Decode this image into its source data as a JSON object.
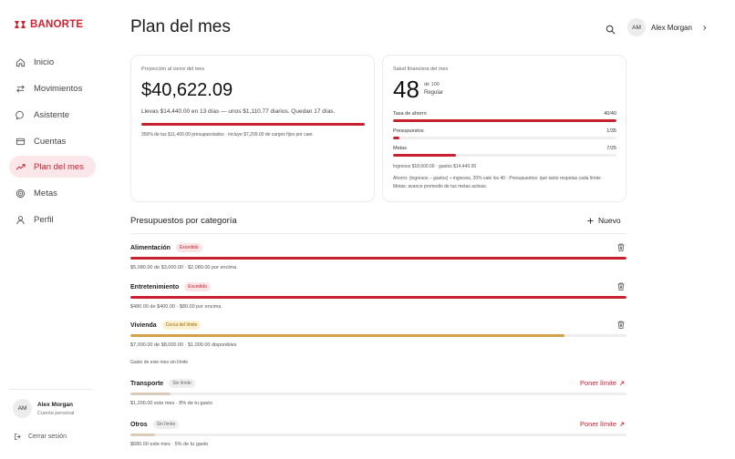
{
  "brand": {
    "name": "BANORTE",
    "color": "#d1202f"
  },
  "sidebar": {
    "items": [
      {
        "label": "Inicio",
        "icon": "home-icon"
      },
      {
        "label": "Movimientos",
        "icon": "transfer-icon"
      },
      {
        "label": "Asistente",
        "icon": "chat-icon"
      },
      {
        "label": "Cuentas",
        "icon": "card-icon"
      },
      {
        "label": "Plan del mes",
        "icon": "trend-icon",
        "active": true
      },
      {
        "label": "Metas",
        "icon": "target-icon"
      },
      {
        "label": "Perfil",
        "icon": "user-icon"
      }
    ],
    "user": {
      "initials": "AM",
      "name": "Alex Morgan",
      "subtitle": "Cuenta personal"
    },
    "logout_label": "Cerrar sesión"
  },
  "header": {
    "title": "Plan del mes",
    "user": {
      "initials": "AM",
      "name": "Alex Morgan"
    }
  },
  "projection": {
    "label": "Proyección al cierre del mes",
    "amount": "$40,622.09",
    "description": "Llevas $14,440.00 en 13 días — unos $1,110.77 diarios. Quedan 17 días.",
    "progress": 1.0,
    "footnote": "356% de tus $11,400.00 presupuestados · incluye $7,299.00 de cargos fijos por caer."
  },
  "health": {
    "label": "Salud financiera del mes",
    "score": "48",
    "out_of": "de 100",
    "status": "Regular",
    "metrics": [
      {
        "label": "Tasa de ahorro",
        "value": "40/40",
        "fraction": 1.0
      },
      {
        "label": "Presupuestos",
        "value": "1/35",
        "fraction": 0.029
      },
      {
        "label": "Metas",
        "value": "7/25",
        "fraction": 0.28
      }
    ],
    "income_line": "Ingresos $18,000.00 · gastos $14,440.00",
    "explanation": "Ahorro: (ingresos − gastos) ÷ ingresos, 20% vale los 40 · Presupuestos: qué tanto respetas cada límite · Metas: avance promedio de tus metas activas."
  },
  "budgets": {
    "title": "Presupuestos por categoría",
    "new_label": "Nuevo",
    "limited": [
      {
        "name": "Alimentación",
        "badge": "Excedido",
        "badge_tone": "red",
        "fraction": 1.0,
        "color": "#c8202f",
        "detail": "$5,080.00 de $3,000.00 · $2,080.00 por encima"
      },
      {
        "name": "Entretenimiento",
        "badge": "Excedido",
        "badge_tone": "red",
        "fraction": 1.0,
        "color": "#c8202f",
        "detail": "$480.00 de $400.00 · $80.00 por encima"
      },
      {
        "name": "Vivienda",
        "badge": "Cerca del límite",
        "badge_tone": "amber",
        "fraction": 0.875,
        "color": "#d4a04a",
        "detail": "$7,000.00 de $8,000.00 · $1,000.00 disponibles"
      }
    ],
    "unlimited_label": "Gasto de este mes sin límite",
    "unlimited": [
      {
        "name": "Transporte",
        "badge": "Sin límite",
        "fraction": 0.08,
        "color": "#d9cbb8",
        "detail": "$1,200.00 este mes · 8% de tu gasto",
        "action": "Poner límite"
      },
      {
        "name": "Otros",
        "badge": "Sin límite",
        "fraction": 0.05,
        "color": "#d9cbb8",
        "detail": "$680.00 este mes · 5% de tu gasto",
        "action": "Poner límite"
      }
    ]
  }
}
